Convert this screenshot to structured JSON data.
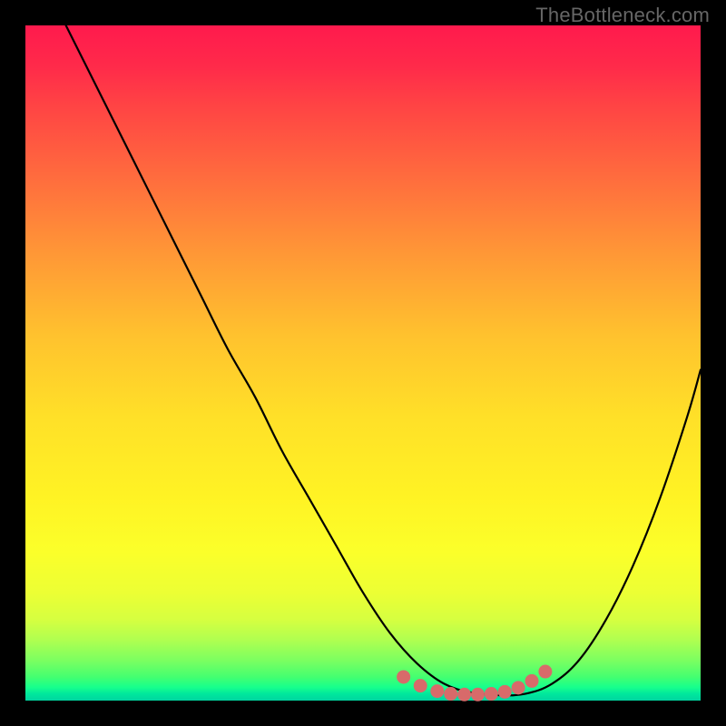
{
  "watermark": "TheBottleneck.com",
  "colors": {
    "page_bg": "#000000",
    "curve": "#000000",
    "dots": "#d86a6a",
    "watermark": "#666666"
  },
  "chart_data": {
    "type": "line",
    "title": "",
    "xlabel": "",
    "ylabel": "",
    "xlim": [
      0,
      100
    ],
    "ylim": [
      0,
      100
    ],
    "grid": false,
    "legend": false,
    "series": [
      {
        "name": "bottleneck-curve",
        "x": [
          6,
          10,
          14,
          18,
          22,
          26,
          30,
          34,
          38,
          42,
          46,
          50,
          54,
          58,
          62,
          66,
          70,
          74,
          78,
          82,
          86,
          90,
          94,
          98,
          100
        ],
        "y": [
          100,
          92,
          84,
          76,
          68,
          60,
          52,
          45,
          37,
          30,
          23,
          16,
          10,
          5.5,
          2.5,
          1.2,
          0.8,
          1.0,
          2.5,
          6,
          12,
          20,
          30,
          42,
          49
        ]
      }
    ],
    "markers": [
      {
        "x": 56.0,
        "y": 3.5
      },
      {
        "x": 58.5,
        "y": 2.2
      },
      {
        "x": 61.0,
        "y": 1.4
      },
      {
        "x": 63.0,
        "y": 1.0
      },
      {
        "x": 65.0,
        "y": 0.9
      },
      {
        "x": 67.0,
        "y": 0.9
      },
      {
        "x": 69.0,
        "y": 1.0
      },
      {
        "x": 71.0,
        "y": 1.3
      },
      {
        "x": 73.0,
        "y": 1.9
      },
      {
        "x": 75.0,
        "y": 2.9
      },
      {
        "x": 77.0,
        "y": 4.3
      }
    ]
  }
}
